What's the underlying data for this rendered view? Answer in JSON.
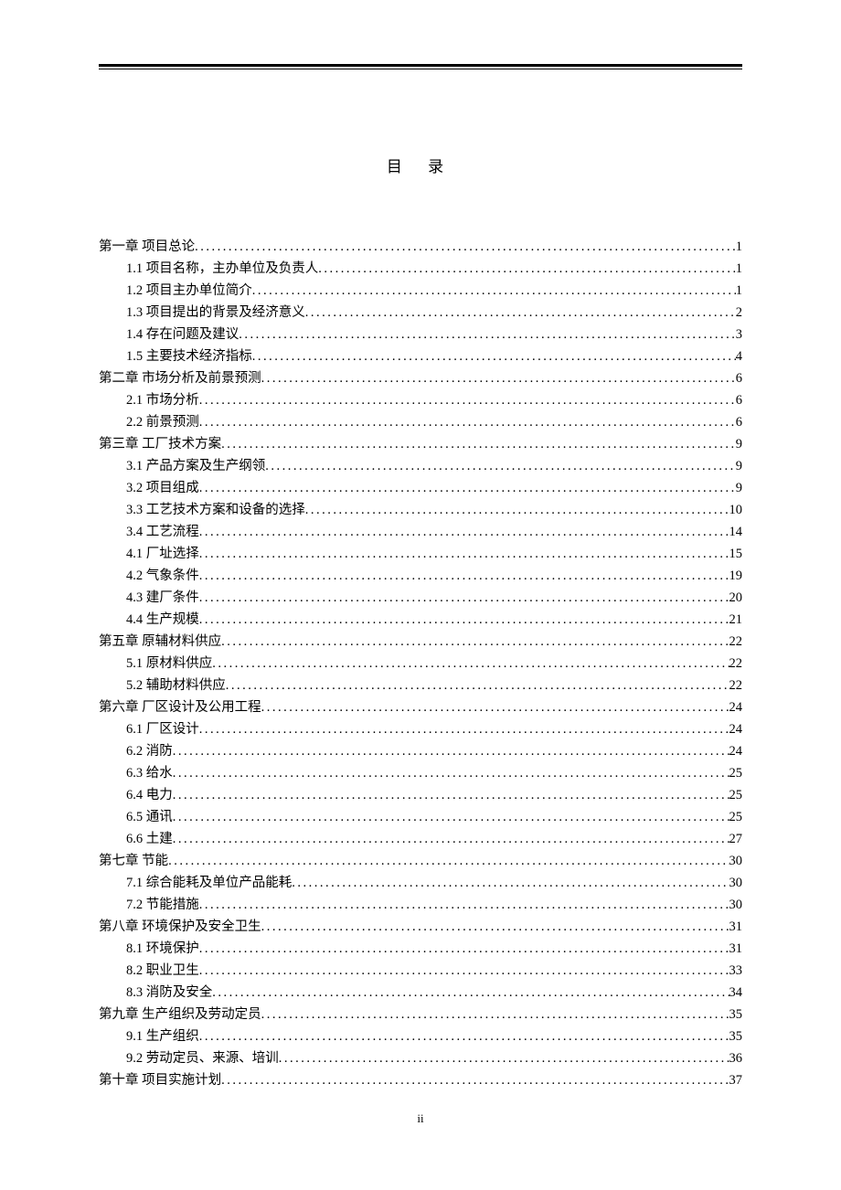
{
  "title": "目 录",
  "page_number": "ii",
  "entries": [
    {
      "level": 0,
      "label": "第一章  项目总论 ",
      "page": "1"
    },
    {
      "level": 1,
      "label": "1.1 项目名称，主办单位及负责人 ",
      "page": "1"
    },
    {
      "level": 1,
      "label": "1.2 项目主办单位简介 ",
      "page": "1"
    },
    {
      "level": 1,
      "label": "1.3 项目提出的背景及经济意义 ",
      "page": "2"
    },
    {
      "level": 1,
      "label": "1.4 存在问题及建议 ",
      "page": "3"
    },
    {
      "level": 1,
      "label": "1.5 主要技术经济指标 ",
      "page": "4"
    },
    {
      "level": 0,
      "label": "第二章   市场分析及前景预测 ",
      "page": "6"
    },
    {
      "level": 1,
      "label": "2.1 市场分析 ",
      "page": "6"
    },
    {
      "level": 1,
      "label": "2.2 前景预测 ",
      "page": "6"
    },
    {
      "level": 0,
      "label": "第三章   工厂技术方案 ",
      "page": "9"
    },
    {
      "level": 1,
      "label": "3.1 产品方案及生产纲领 ",
      "page": "9"
    },
    {
      "level": 1,
      "label": "3.2 项目组成 ",
      "page": "9"
    },
    {
      "level": 1,
      "label": "3.3 工艺技术方案和设备的选择 ",
      "page": "10"
    },
    {
      "level": 1,
      "label": "3.4 工艺流程",
      "page": "14"
    },
    {
      "level": 1,
      "label": "4.1 厂址选择 ",
      "page": "15"
    },
    {
      "level": 1,
      "label": "4.2 气象条件 ",
      "page": "19"
    },
    {
      "level": 1,
      "label": "4.3 建厂条件",
      "page": "20"
    },
    {
      "level": 1,
      "label": "4.4 生产规模 ",
      "page": "21"
    },
    {
      "level": 0,
      "label": "第五章   原辅材料供应 ",
      "page": "22"
    },
    {
      "level": 1,
      "label": "5.1 原材料供应 ",
      "page": "22"
    },
    {
      "level": 1,
      "label": "5.2 辅助材料供应 ",
      "page": "22"
    },
    {
      "level": 0,
      "label": "第六章  厂区设计及公用工程 ",
      "page": "24"
    },
    {
      "level": 1,
      "label": "6.1 厂区设计 ",
      "page": "24"
    },
    {
      "level": 1,
      "label": "6.2 消防 ",
      "page": "24"
    },
    {
      "level": 1,
      "label": "6.3 给水 ",
      "page": "25"
    },
    {
      "level": 1,
      "label": "6.4 电力 ",
      "page": "25"
    },
    {
      "level": 1,
      "label": "6.5 通讯 ",
      "page": "25"
    },
    {
      "level": 1,
      "label": "6.6 土建 ",
      "page": "27"
    },
    {
      "level": 0,
      "label": "第七章  节能 ",
      "page": "30"
    },
    {
      "level": 1,
      "label": "7.1 综合能耗及单位产品能耗 ",
      "page": "30"
    },
    {
      "level": 1,
      "label": "7.2 节能措施 ",
      "page": "30"
    },
    {
      "level": 0,
      "label": "第八章  环境保护及安全卫生 ",
      "page": "31"
    },
    {
      "level": 1,
      "label": "8.1 环境保护 ",
      "page": "31"
    },
    {
      "level": 1,
      "label": "8.2 职业卫生 ",
      "page": "33"
    },
    {
      "level": 1,
      "label": "8.3 消防及安全 ",
      "page": "34"
    },
    {
      "level": 0,
      "label": "第九章   生产组织及劳动定员 ",
      "page": "35"
    },
    {
      "level": 1,
      "label": "9.1 生产组织 ",
      "page": "35"
    },
    {
      "level": 1,
      "label": "9.2 劳动定员、来源、培训 ",
      "page": "36"
    },
    {
      "level": 0,
      "label": "第十章  项目实施计划 ",
      "page": "37"
    }
  ]
}
